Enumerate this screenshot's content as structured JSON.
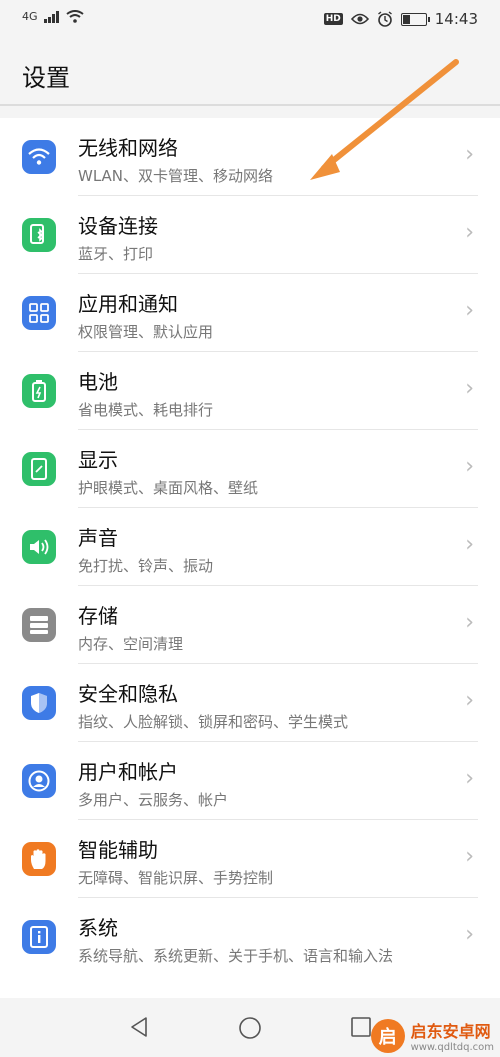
{
  "statusbar": {
    "network": "4G",
    "hd": "HD",
    "time": "14:43"
  },
  "page": {
    "title": "设置"
  },
  "items": [
    {
      "label": "无线和网络",
      "sub": "WLAN、双卡管理、移动网络",
      "color": "#3e7be6",
      "icon": "wifi-icon"
    },
    {
      "label": "设备连接",
      "sub": "蓝牙、打印",
      "color": "#2fbf6a",
      "icon": "device-connect-icon"
    },
    {
      "label": "应用和通知",
      "sub": "权限管理、默认应用",
      "color": "#3e7be6",
      "icon": "apps-grid-icon"
    },
    {
      "label": "电池",
      "sub": "省电模式、耗电排行",
      "color": "#2fbf6a",
      "icon": "battery-icon"
    },
    {
      "label": "显示",
      "sub": "护眼模式、桌面风格、壁纸",
      "color": "#2fbf6a",
      "icon": "display-icon"
    },
    {
      "label": "声音",
      "sub": "免打扰、铃声、振动",
      "color": "#2fbf6a",
      "icon": "speaker-icon"
    },
    {
      "label": "存储",
      "sub": "内存、空间清理",
      "color": "#8a8a8a",
      "icon": "storage-icon"
    },
    {
      "label": "安全和隐私",
      "sub": "指纹、人脸解锁、锁屏和密码、学生模式",
      "color": "#3e7be6",
      "icon": "shield-icon"
    },
    {
      "label": "用户和帐户",
      "sub": "多用户、云服务、帐户",
      "color": "#3e7be6",
      "icon": "user-icon"
    },
    {
      "label": "智能辅助",
      "sub": "无障碍、智能识屏、手势控制",
      "color": "#f07a22",
      "icon": "hand-icon"
    },
    {
      "label": "系统",
      "sub": "系统导航、系统更新、关于手机、语言和输入法",
      "color": "#3e7be6",
      "icon": "system-info-icon"
    }
  ],
  "annotation": {
    "color": "#f0913a"
  },
  "watermark": {
    "logo": "启",
    "title": "启东安卓网",
    "url": "www.qdltdq.com"
  }
}
